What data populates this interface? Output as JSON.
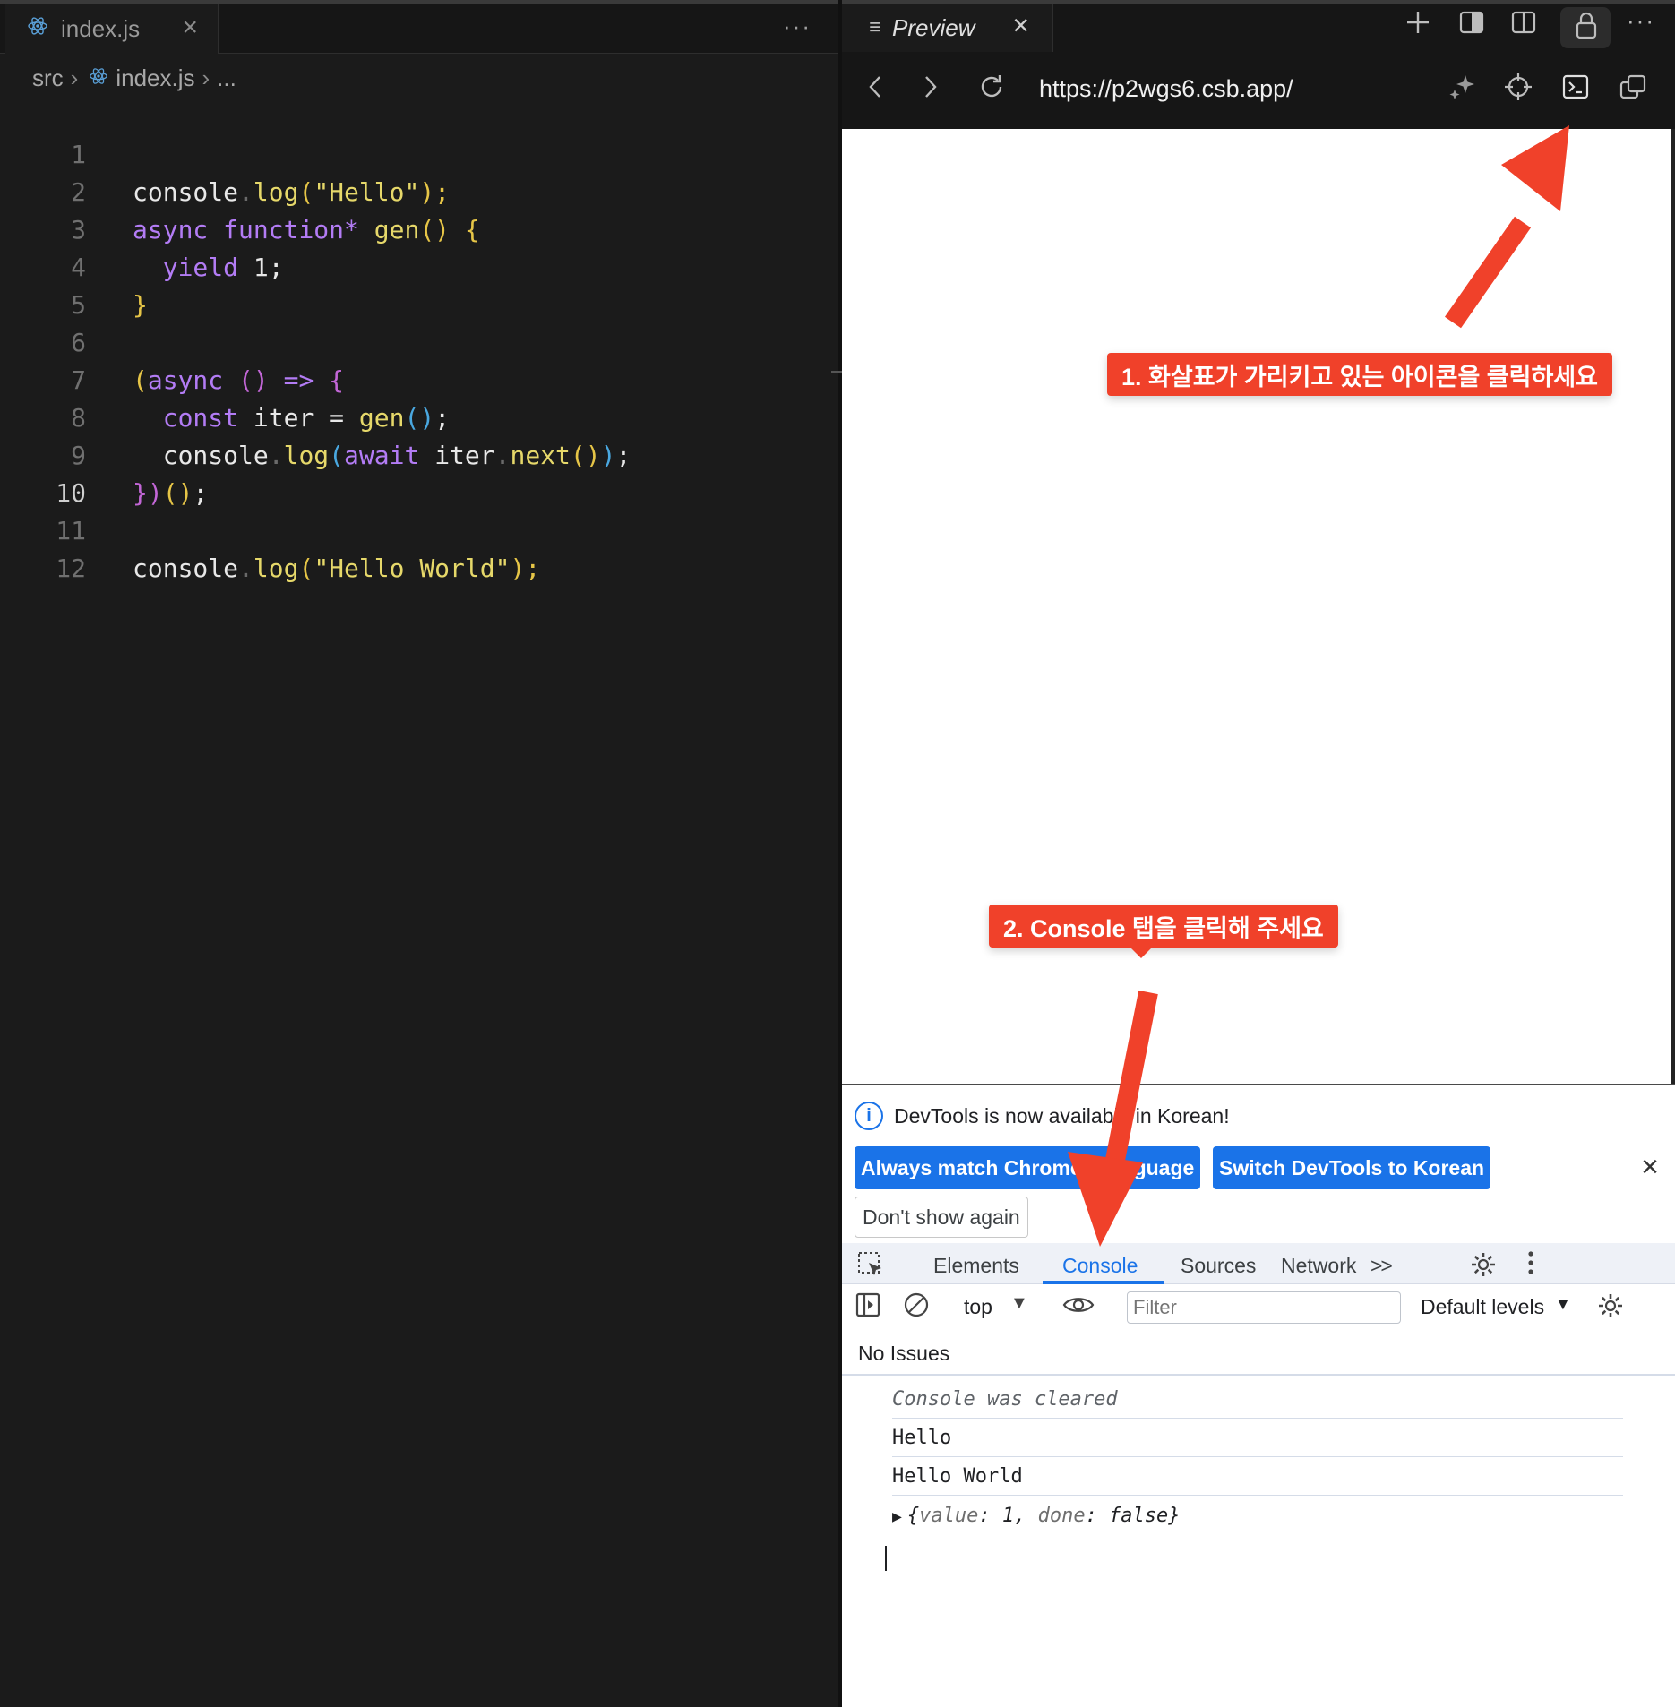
{
  "editor": {
    "tab_label": "index.js",
    "breadcrumb": {
      "folder": "src",
      "file": "index.js",
      "ellipsis": "..."
    },
    "more": "···",
    "lines": [
      {
        "n": "1"
      },
      {
        "n": "2"
      },
      {
        "n": "3"
      },
      {
        "n": "4"
      },
      {
        "n": "5"
      },
      {
        "n": "6"
      },
      {
        "n": "7"
      },
      {
        "n": "8"
      },
      {
        "n": "9"
      },
      {
        "n": "10"
      },
      {
        "n": "11"
      },
      {
        "n": "12"
      }
    ],
    "active_line": "10",
    "code": {
      "l1": [
        "console",
        ".",
        "log",
        "(",
        "\"Hello\"",
        ");"
      ],
      "l2": [
        "async",
        "function*",
        "gen",
        "()",
        "{"
      ],
      "l3": [
        "yield",
        "1",
        ";"
      ],
      "l4": [
        "}"
      ],
      "l6": [
        "(",
        "async",
        "()",
        "=>",
        "{"
      ],
      "l7": [
        "const",
        "iter",
        "=",
        "gen",
        "()",
        ";"
      ],
      "l8": [
        "console",
        ".",
        "log",
        "(",
        "await",
        "iter",
        ".",
        "next",
        "()",
        ")",
        ";"
      ],
      "l9": [
        "})",
        "()",
        ";"
      ],
      "l11": [
        "console",
        ".",
        "log",
        "(",
        "\"Hello World\"",
        ");"
      ]
    }
  },
  "preview": {
    "tab_label": "Preview",
    "url": "https://p2wgs6.csb.app/",
    "icons": [
      "plus-icon",
      "sidebar-icon",
      "split-icon",
      "lock-icon",
      "more-icon",
      "back-icon",
      "forward-icon",
      "reload-icon",
      "sparkle-icon",
      "crosshair-icon",
      "terminal-icon",
      "popout-icon"
    ]
  },
  "devtools": {
    "info_text": "DevTools is now available in Korean!",
    "btn_match": "Always match Chrome's language",
    "btn_switch": "Switch DevTools to Korean",
    "btn_dont_show": "Don't show again",
    "tabs": [
      "Elements",
      "Console",
      "Sources",
      "Network"
    ],
    "more_tabs": ">>",
    "context": "top",
    "filter_placeholder": "Filter",
    "levels": "Default levels",
    "no_issues": "No Issues",
    "messages": [
      "Console was cleared",
      "Hello",
      "Hello World"
    ],
    "object_preview": {
      "open": "{",
      "k1": "value",
      "v1": "1",
      "k2": "done",
      "v2": "false",
      "close": "}"
    }
  },
  "annotations": {
    "callout1": "1. 화살표가 가리키고 있는 아이콘을 클릭하세요",
    "callout2": "2. Console 탭을 클릭해 주세요",
    "color": "#f0412a"
  }
}
